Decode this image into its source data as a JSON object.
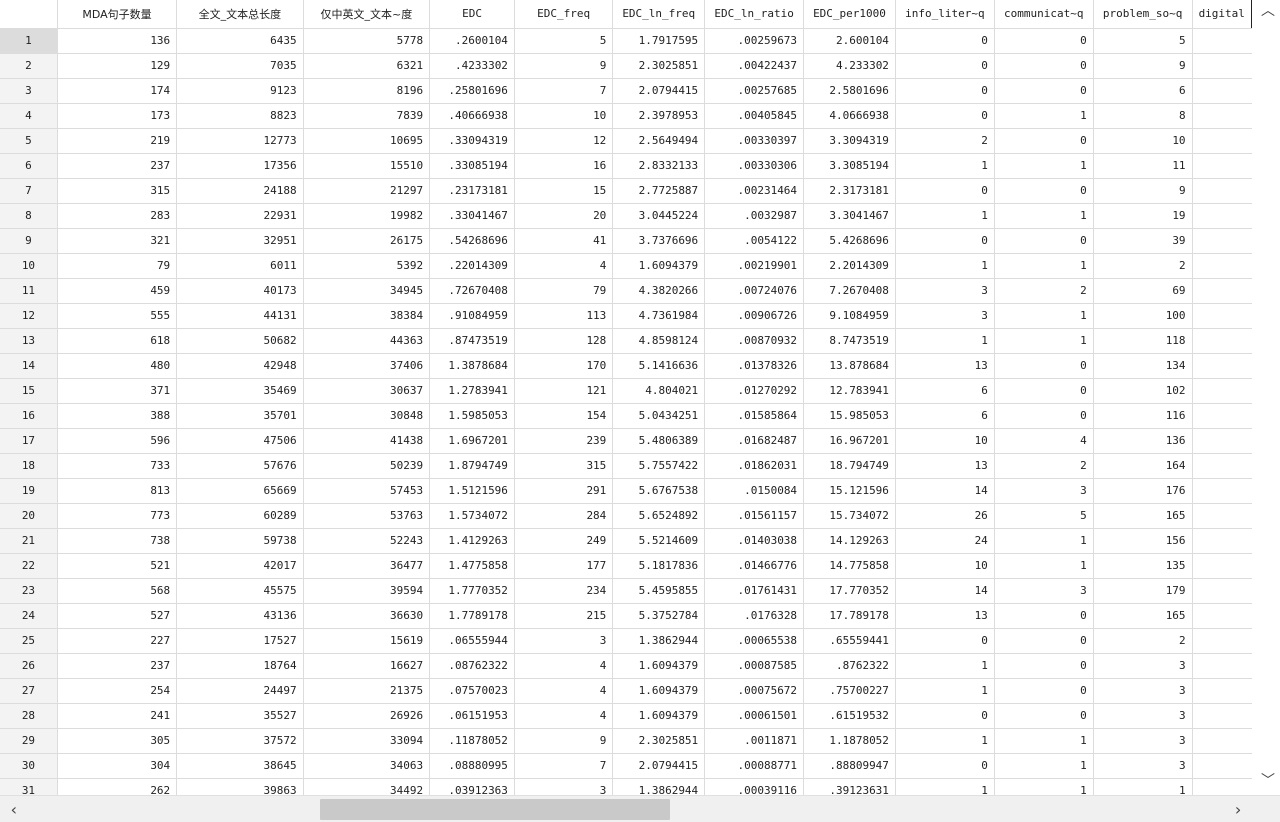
{
  "columns": [
    "MDA句子数量",
    "全文_文本总长度",
    "仅中英文_文本~度",
    "EDC",
    "EDC_freq",
    "EDC_ln_freq",
    "EDC_ln_ratio",
    "EDC_per1000",
    "info_liter~q",
    "communicat~q",
    "problem_so~q",
    "digital"
  ],
  "rows": [
    [
      "1",
      "136",
      "6435",
      "5778",
      ".2600104",
      "5",
      "1.7917595",
      ".00259673",
      "2.600104",
      "0",
      "0",
      "5",
      ""
    ],
    [
      "2",
      "129",
      "7035",
      "6321",
      ".4233302",
      "9",
      "2.3025851",
      ".00422437",
      "4.233302",
      "0",
      "0",
      "9",
      ""
    ],
    [
      "3",
      "174",
      "9123",
      "8196",
      ".25801696",
      "7",
      "2.0794415",
      ".00257685",
      "2.5801696",
      "0",
      "0",
      "6",
      ""
    ],
    [
      "4",
      "173",
      "8823",
      "7839",
      ".40666938",
      "10",
      "2.3978953",
      ".00405845",
      "4.0666938",
      "0",
      "1",
      "8",
      ""
    ],
    [
      "5",
      "219",
      "12773",
      "10695",
      ".33094319",
      "12",
      "2.5649494",
      ".00330397",
      "3.3094319",
      "2",
      "0",
      "10",
      ""
    ],
    [
      "6",
      "237",
      "17356",
      "15510",
      ".33085194",
      "16",
      "2.8332133",
      ".00330306",
      "3.3085194",
      "1",
      "1",
      "11",
      ""
    ],
    [
      "7",
      "315",
      "24188",
      "21297",
      ".23173181",
      "15",
      "2.7725887",
      ".00231464",
      "2.3173181",
      "0",
      "0",
      "9",
      ""
    ],
    [
      "8",
      "283",
      "22931",
      "19982",
      ".33041467",
      "20",
      "3.0445224",
      ".0032987",
      "3.3041467",
      "1",
      "1",
      "19",
      ""
    ],
    [
      "9",
      "321",
      "32951",
      "26175",
      ".54268696",
      "41",
      "3.7376696",
      ".0054122",
      "5.4268696",
      "0",
      "0",
      "39",
      ""
    ],
    [
      "10",
      "79",
      "6011",
      "5392",
      ".22014309",
      "4",
      "1.6094379",
      ".00219901",
      "2.2014309",
      "1",
      "1",
      "2",
      ""
    ],
    [
      "11",
      "459",
      "40173",
      "34945",
      ".72670408",
      "79",
      "4.3820266",
      ".00724076",
      "7.2670408",
      "3",
      "2",
      "69",
      ""
    ],
    [
      "12",
      "555",
      "44131",
      "38384",
      ".91084959",
      "113",
      "4.7361984",
      ".00906726",
      "9.1084959",
      "3",
      "1",
      "100",
      ""
    ],
    [
      "13",
      "618",
      "50682",
      "44363",
      ".87473519",
      "128",
      "4.8598124",
      ".00870932",
      "8.7473519",
      "1",
      "1",
      "118",
      ""
    ],
    [
      "14",
      "480",
      "42948",
      "37406",
      "1.3878684",
      "170",
      "5.1416636",
      ".01378326",
      "13.878684",
      "13",
      "0",
      "134",
      ""
    ],
    [
      "15",
      "371",
      "35469",
      "30637",
      "1.2783941",
      "121",
      "4.804021",
      ".01270292",
      "12.783941",
      "6",
      "0",
      "102",
      ""
    ],
    [
      "16",
      "388",
      "35701",
      "30848",
      "1.5985053",
      "154",
      "5.0434251",
      ".01585864",
      "15.985053",
      "6",
      "0",
      "116",
      ""
    ],
    [
      "17",
      "596",
      "47506",
      "41438",
      "1.6967201",
      "239",
      "5.4806389",
      ".01682487",
      "16.967201",
      "10",
      "4",
      "136",
      ""
    ],
    [
      "18",
      "733",
      "57676",
      "50239",
      "1.8794749",
      "315",
      "5.7557422",
      ".01862031",
      "18.794749",
      "13",
      "2",
      "164",
      ""
    ],
    [
      "19",
      "813",
      "65669",
      "57453",
      "1.5121596",
      "291",
      "5.6767538",
      ".0150084",
      "15.121596",
      "14",
      "3",
      "176",
      ""
    ],
    [
      "20",
      "773",
      "60289",
      "53763",
      "1.5734072",
      "284",
      "5.6524892",
      ".01561157",
      "15.734072",
      "26",
      "5",
      "165",
      ""
    ],
    [
      "21",
      "738",
      "59738",
      "52243",
      "1.4129263",
      "249",
      "5.5214609",
      ".01403038",
      "14.129263",
      "24",
      "1",
      "156",
      ""
    ],
    [
      "22",
      "521",
      "42017",
      "36477",
      "1.4775858",
      "177",
      "5.1817836",
      ".01466776",
      "14.775858",
      "10",
      "1",
      "135",
      ""
    ],
    [
      "23",
      "568",
      "45575",
      "39594",
      "1.7770352",
      "234",
      "5.4595855",
      ".01761431",
      "17.770352",
      "14",
      "3",
      "179",
      ""
    ],
    [
      "24",
      "527",
      "43136",
      "36630",
      "1.7789178",
      "215",
      "5.3752784",
      ".0176328",
      "17.789178",
      "13",
      "0",
      "165",
      ""
    ],
    [
      "25",
      "227",
      "17527",
      "15619",
      ".06555944",
      "3",
      "1.3862944",
      ".00065538",
      ".65559441",
      "0",
      "0",
      "2",
      ""
    ],
    [
      "26",
      "237",
      "18764",
      "16627",
      ".08762322",
      "4",
      "1.6094379",
      ".00087585",
      ".8762322",
      "1",
      "0",
      "3",
      ""
    ],
    [
      "27",
      "254",
      "24497",
      "21375",
      ".07570023",
      "4",
      "1.6094379",
      ".00075672",
      ".75700227",
      "1",
      "0",
      "3",
      ""
    ],
    [
      "28",
      "241",
      "35527",
      "26926",
      ".06151953",
      "4",
      "1.6094379",
      ".00061501",
      ".61519532",
      "0",
      "0",
      "3",
      ""
    ],
    [
      "29",
      "305",
      "37572",
      "33094",
      ".11878052",
      "9",
      "2.3025851",
      ".0011871",
      "1.1878052",
      "1",
      "1",
      "3",
      ""
    ],
    [
      "30",
      "304",
      "38645",
      "34063",
      ".08880995",
      "7",
      "2.0794415",
      ".00088771",
      ".88809947",
      "0",
      "1",
      "3",
      ""
    ],
    [
      "31",
      "262",
      "39863",
      "34492",
      ".03912363",
      "3",
      "1.3862944",
      ".00039116",
      ".39123631",
      "1",
      "1",
      "1",
      ""
    ]
  ],
  "icons": {
    "scroll_up": "chevron-up-icon",
    "scroll_down": "chevron-down-icon",
    "scroll_left": "chevron-left-icon",
    "scroll_right": "chevron-right-icon"
  }
}
